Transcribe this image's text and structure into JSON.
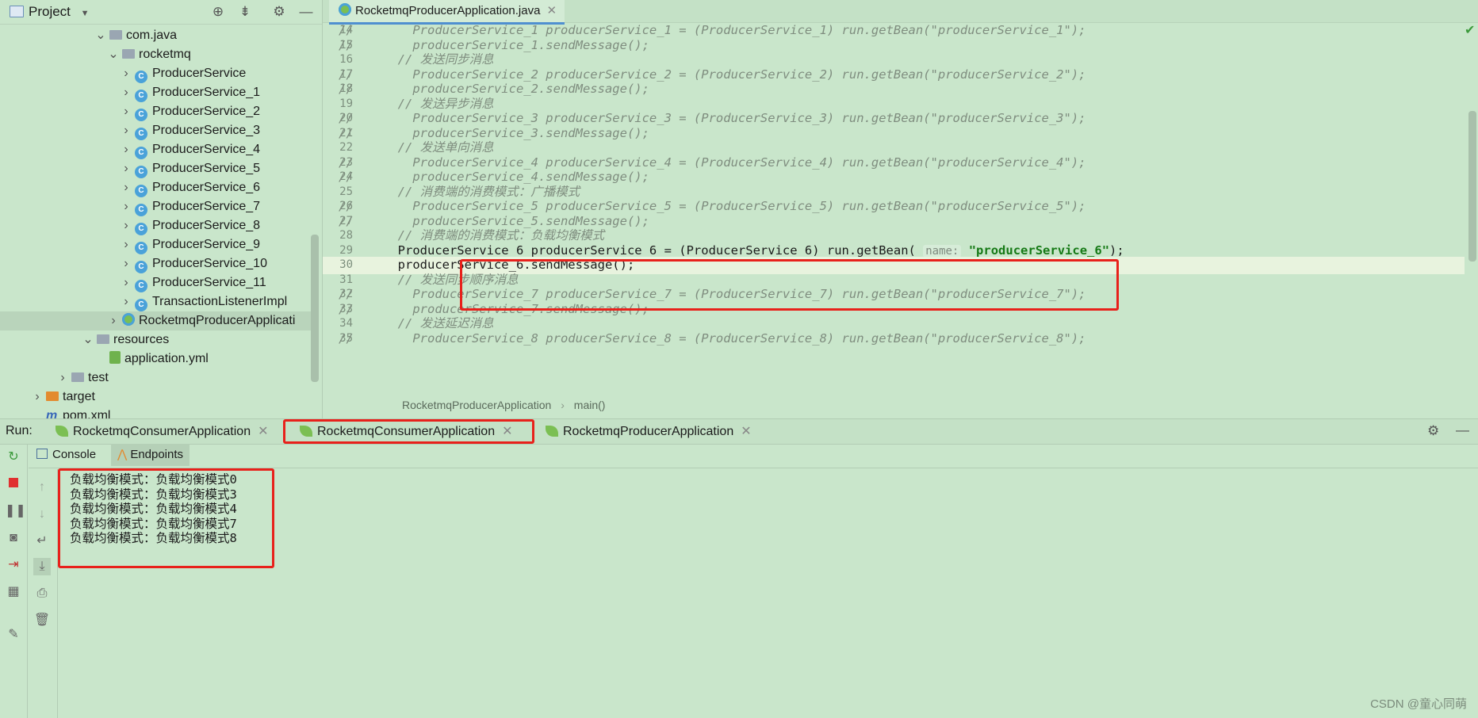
{
  "project": {
    "title": "Project",
    "tree": [
      {
        "label": "com.java",
        "indent": 7,
        "kind": "folder",
        "arrow": "v"
      },
      {
        "label": "rocketmq",
        "indent": 8,
        "kind": "folder",
        "arrow": "v"
      },
      {
        "label": "ProducerService",
        "indent": 9,
        "kind": "class",
        "arrow": ">"
      },
      {
        "label": "ProducerService_1",
        "indent": 9,
        "kind": "class",
        "arrow": ">"
      },
      {
        "label": "ProducerService_2",
        "indent": 9,
        "kind": "class",
        "arrow": ">"
      },
      {
        "label": "ProducerService_3",
        "indent": 9,
        "kind": "class",
        "arrow": ">"
      },
      {
        "label": "ProducerService_4",
        "indent": 9,
        "kind": "class",
        "arrow": ">"
      },
      {
        "label": "ProducerService_5",
        "indent": 9,
        "kind": "class",
        "arrow": ">"
      },
      {
        "label": "ProducerService_6",
        "indent": 9,
        "kind": "class",
        "arrow": ">"
      },
      {
        "label": "ProducerService_7",
        "indent": 9,
        "kind": "class",
        "arrow": ">"
      },
      {
        "label": "ProducerService_8",
        "indent": 9,
        "kind": "class",
        "arrow": ">"
      },
      {
        "label": "ProducerService_9",
        "indent": 9,
        "kind": "class",
        "arrow": ">"
      },
      {
        "label": "ProducerService_10",
        "indent": 9,
        "kind": "class",
        "arrow": ">"
      },
      {
        "label": "ProducerService_11",
        "indent": 9,
        "kind": "class",
        "arrow": ">"
      },
      {
        "label": "TransactionListenerImpl",
        "indent": 9,
        "kind": "class",
        "arrow": ">"
      },
      {
        "label": "RocketmqProducerApplicati",
        "indent": 8,
        "kind": "spring",
        "arrow": ">",
        "selected": true
      },
      {
        "label": "resources",
        "indent": 6,
        "kind": "folder",
        "arrow": "v"
      },
      {
        "label": "application.yml",
        "indent": 7,
        "kind": "yml",
        "arrow": ""
      },
      {
        "label": "test",
        "indent": 4,
        "kind": "folder",
        "arrow": ">"
      },
      {
        "label": "target",
        "indent": 2,
        "kind": "folder-orange",
        "arrow": ">"
      },
      {
        "label": "pom.xml",
        "indent": 2,
        "kind": "maven",
        "arrow": ""
      }
    ]
  },
  "editor": {
    "file_tab": "RocketmqProducerApplication.java",
    "breadcrumb": [
      "RocketmqProducerApplication",
      "main()"
    ],
    "lines": [
      {
        "n": "14",
        "parts": [
          [
            "cm",
            "//        ProducerService_1 producerService_1 = (ProducerService_1) run.getBean(\"producerService_1\");"
          ]
        ]
      },
      {
        "n": "15",
        "parts": [
          [
            "cm",
            "//        producerService_1.sendMessage();"
          ]
        ]
      },
      {
        "n": "16",
        "parts": [
          [
            "cm",
            "        // 发送同步消息"
          ]
        ]
      },
      {
        "n": "17",
        "parts": [
          [
            "cm",
            "//        ProducerService_2 producerService_2 = (ProducerService_2) run.getBean(\"producerService_2\");"
          ]
        ]
      },
      {
        "n": "18",
        "parts": [
          [
            "cm",
            "//        producerService_2.sendMessage();"
          ]
        ]
      },
      {
        "n": "19",
        "parts": [
          [
            "cm",
            "        // 发送异步消息"
          ]
        ]
      },
      {
        "n": "20",
        "parts": [
          [
            "cm",
            "//        ProducerService_3 producerService_3 = (ProducerService_3) run.getBean(\"producerService_3\");"
          ]
        ]
      },
      {
        "n": "21",
        "parts": [
          [
            "cm",
            "//        producerService_3.sendMessage();"
          ]
        ]
      },
      {
        "n": "22",
        "parts": [
          [
            "cm",
            "        // 发送单向消息"
          ]
        ]
      },
      {
        "n": "23",
        "parts": [
          [
            "cm",
            "//        ProducerService_4 producerService_4 = (ProducerService_4) run.getBean(\"producerService_4\");"
          ]
        ]
      },
      {
        "n": "24",
        "parts": [
          [
            "cm",
            "//        producerService_4.sendMessage();"
          ]
        ]
      },
      {
        "n": "25",
        "parts": [
          [
            "cm",
            "        // 消费端的消费模式：广播模式"
          ]
        ]
      },
      {
        "n": "26",
        "parts": [
          [
            "cm",
            "//        ProducerService_5 producerService_5 = (ProducerService_5) run.getBean(\"producerService_5\");"
          ]
        ]
      },
      {
        "n": "27",
        "parts": [
          [
            "cm",
            "//        producerService_5.sendMessage();"
          ]
        ]
      },
      {
        "n": "28",
        "parts": [
          [
            "cm",
            "        // 消费端的消费模式：负载均衡模式"
          ]
        ]
      },
      {
        "n": "29",
        "parts": [
          [
            "tx",
            "        ProducerService_6 producerService_6 = (ProducerService_6) run.getBean( "
          ],
          [
            "hint",
            "name:"
          ],
          [
            "tx",
            " "
          ],
          [
            "str",
            "\"producerService_6\""
          ],
          [
            "tx",
            ");"
          ]
        ]
      },
      {
        "n": "30",
        "parts": [
          [
            "tx",
            "        producerService_6.sendMessage();"
          ]
        ],
        "current": true
      },
      {
        "n": "31",
        "parts": [
          [
            "cm",
            "        // 发送同步顺序消息"
          ]
        ]
      },
      {
        "n": "32",
        "parts": [
          [
            "cm",
            "//        ProducerService_7 producerService_7 = (ProducerService_7) run.getBean(\"producerService_7\");"
          ]
        ]
      },
      {
        "n": "33",
        "parts": [
          [
            "cm",
            "//        producerService_7.sendMessage();"
          ]
        ]
      },
      {
        "n": "34",
        "parts": [
          [
            "cm",
            "        // 发送延迟消息"
          ]
        ]
      },
      {
        "n": "35",
        "parts": [
          [
            "cm",
            "//        ProducerService_8 producerService_8 = (ProducerService_8) run.getBean(\"producerService_8\");"
          ]
        ]
      }
    ]
  },
  "run": {
    "label": "Run:",
    "tabs": [
      "RocketmqConsumerApplication",
      "RocketmqConsumerApplication",
      "RocketmqProducerApplication"
    ],
    "console_tab": "Console",
    "endpoints_tab": "Endpoints",
    "output": [
      "负载均衡模式：负载均衡模式0",
      "负载均衡模式：负载均衡模式3",
      "负载均衡模式：负载均衡模式4",
      "负载均衡模式：负载均衡模式7",
      "负载均衡模式：负载均衡模式8"
    ]
  },
  "watermark": "CSDN @童心同萌",
  "colors": {
    "highlight_box": "#e8211b",
    "background": "#c9e6cb",
    "string": "#167a16"
  }
}
